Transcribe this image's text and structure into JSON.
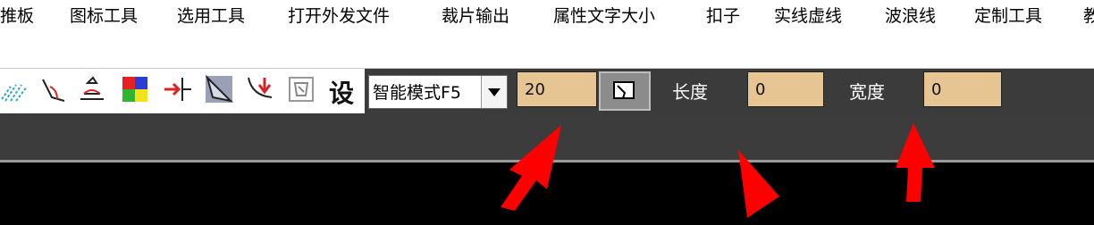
{
  "menu": {
    "items": [
      "推板",
      "图标工具",
      "选用工具",
      "打开外发文件",
      "裁片输出",
      "属性文字大小",
      "扣子",
      "实线虚线",
      "波浪线",
      "定制工具",
      "教"
    ]
  },
  "toolbar": {
    "tool_icons": [
      "wave-line-tool-icon",
      "angle-tool-icon",
      "notch-tool-icon",
      "color-palette-icon",
      "split-point-tool-icon",
      "triangle-fold-tool-icon",
      "down-arrow-curve-tool-icon",
      "pattern-piece-tool-icon"
    ],
    "settings_label": "设",
    "mode_select_value": "智能模式F5",
    "size_value": "20",
    "length_label": "长度",
    "length_value": "0",
    "width_label": "宽度",
    "width_value": "0"
  },
  "colors": {
    "field_bg": "#e6c592",
    "panel_bg": "#3b3b3b",
    "annotation_arrow": "#ff0000"
  }
}
